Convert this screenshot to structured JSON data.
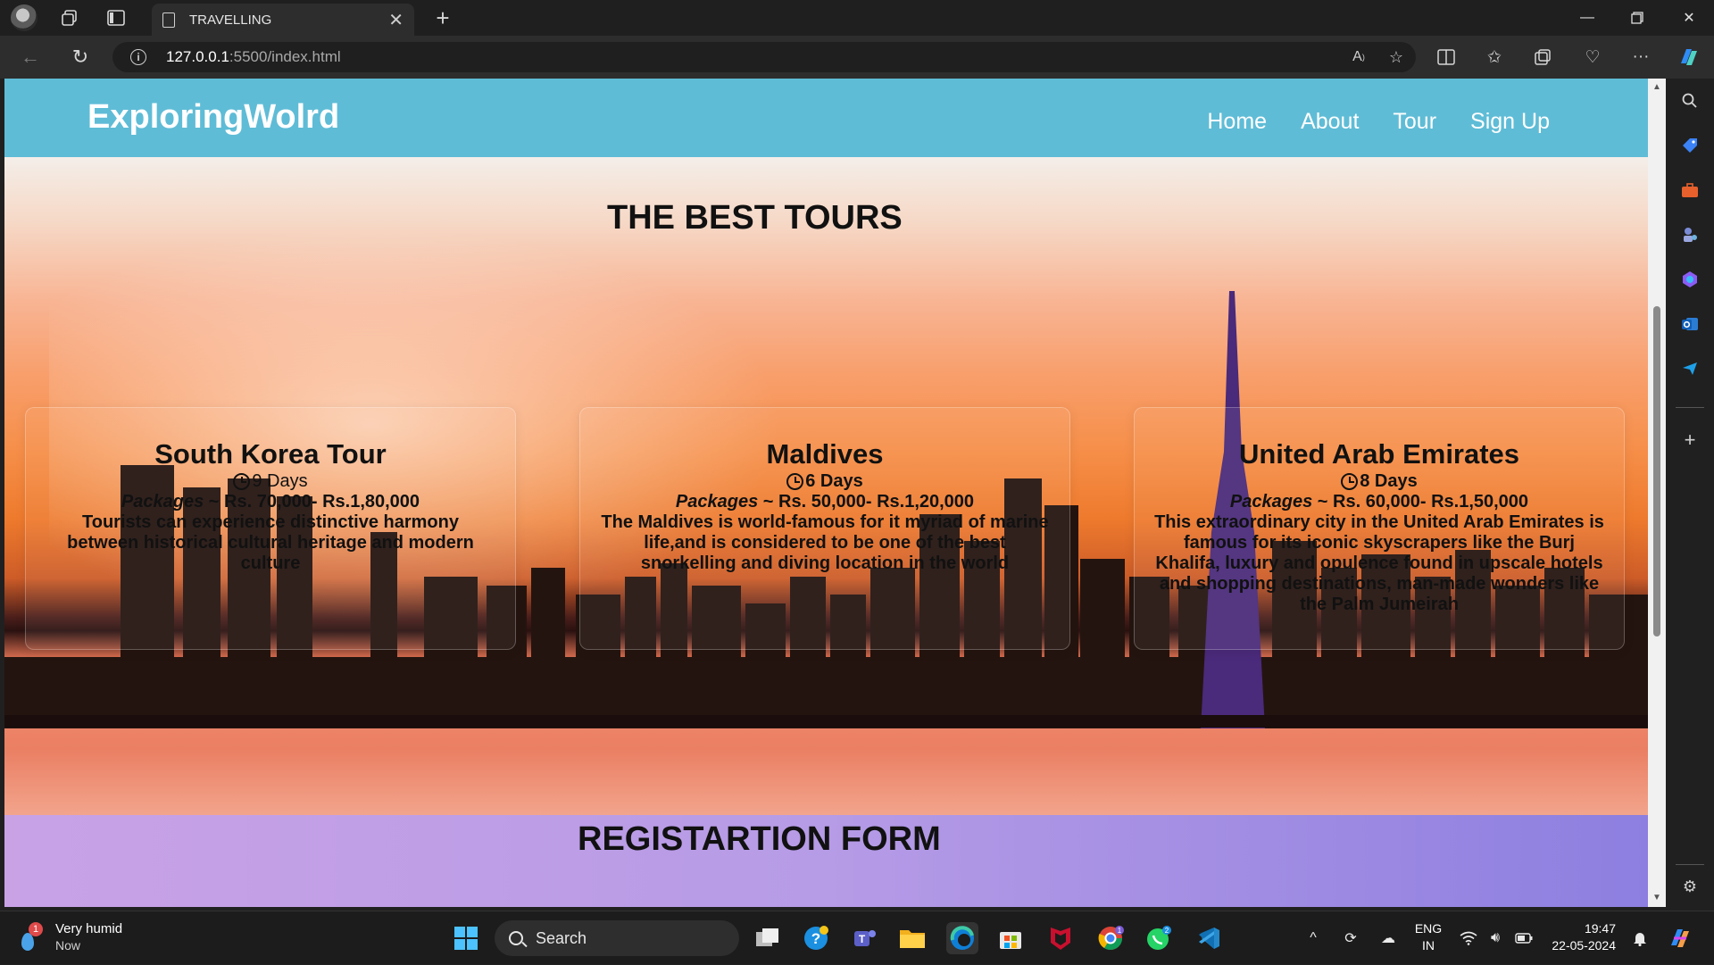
{
  "browser": {
    "tab_title": "TRAVELLING",
    "url_host": "127.0.0.1",
    "url_path": ":5500/index.html"
  },
  "site": {
    "logo": "ExploringWolrd",
    "nav": [
      "Home",
      "About",
      "Tour",
      "Sign Up"
    ],
    "tours_heading": "THE BEST TOURS",
    "registration_heading": "REGISTARTION FORM",
    "cards": [
      {
        "title": "South Korea Tour",
        "days": "9 Days",
        "packages_label": "Packages",
        "packages_value": " ~ Rs. 70,000- Rs.1,80,000",
        "description": "Tourists can experience distinctive harmony between historical cultural heritage and modern culture"
      },
      {
        "title": "Maldives",
        "days": "6 Days",
        "packages_label": "Packages",
        "packages_value": " ~ Rs. 50,000- Rs.1,20,000",
        "description": "The Maldives is world-famous for it myriad of marine life,and is considered to be one of the best snorkelling and diving location in the world"
      },
      {
        "title": "United Arab Emirates",
        "days": "8 Days",
        "packages_label": "Packages",
        "packages_value": " ~ Rs. 60,000- Rs.1,50,000",
        "description": "This extraordinary city in the United Arab Emirates is famous for its iconic skyscrapers like the Burj Khalifa, luxury and opulence found in upscale hotels and shopping destinations, man-made wonders like the Palm Jumeirah"
      }
    ]
  },
  "taskbar": {
    "weather_title": "Very humid",
    "weather_sub": "Now",
    "weather_badge": "1",
    "search_label": "Search",
    "lang_top": "ENG",
    "lang_bottom": "IN",
    "time": "19:47",
    "date": "22-05-2024",
    "teams_badge": "1",
    "whatsapp_badge": "2"
  },
  "colors": {
    "header_bg": "#5fbcd6",
    "registration_bg": "#b69be6",
    "chrome_bg": "#1f1f1f"
  },
  "icons": [
    "profile-avatar-icon",
    "workspaces-icon",
    "tab-actions-icon",
    "page-icon",
    "close-icon",
    "plus-icon",
    "back-icon",
    "refresh-icon",
    "info-icon",
    "read-aloud-icon",
    "star-icon",
    "split-screen-icon",
    "favorites-icon",
    "collections-icon",
    "browser-essentials-icon",
    "more-icon",
    "copilot-icon",
    "clock-icon",
    "windows-start-icon"
  ]
}
